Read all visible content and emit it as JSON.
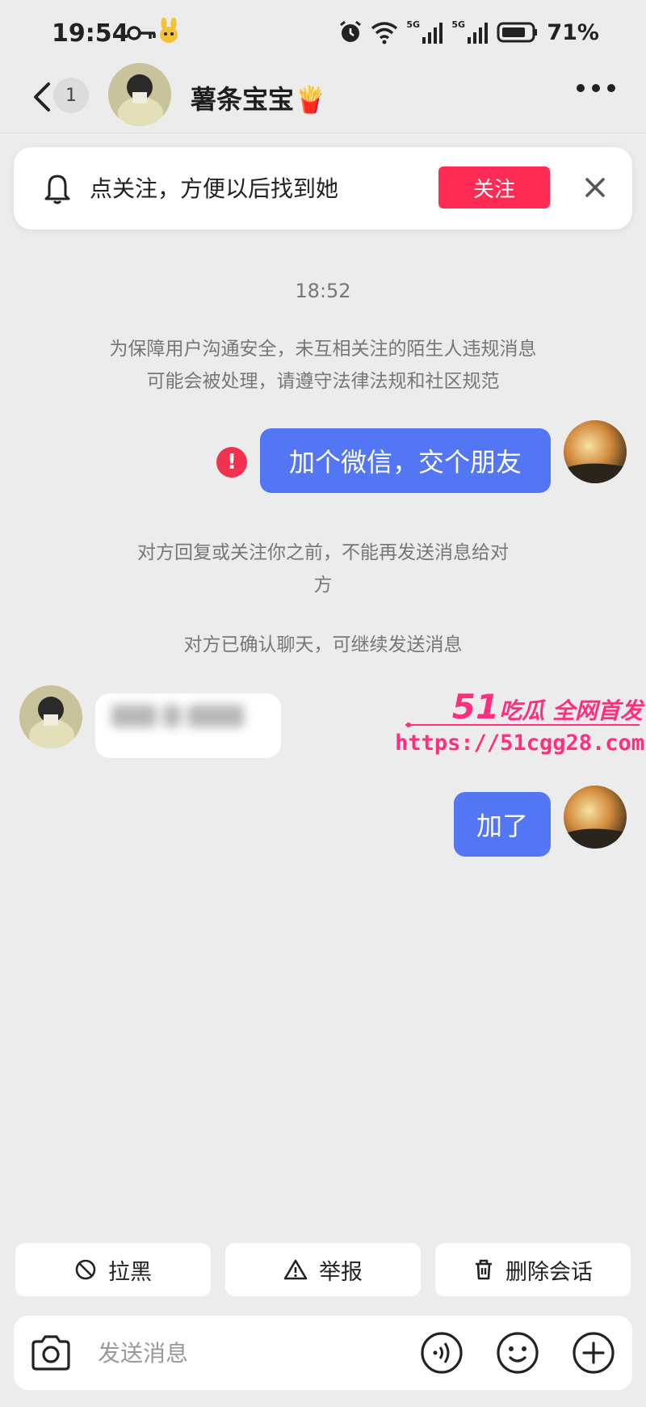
{
  "status_bar": {
    "time": "19:54",
    "battery": "71%",
    "network_1": "5G",
    "network_2": "5G"
  },
  "header": {
    "unread_count": "1",
    "title": "薯条宝宝🍟"
  },
  "follow_banner": {
    "text": "点关注，方便以后找到她",
    "button": "关注",
    "accent": "#fe2c55"
  },
  "messages": {
    "timestamp": "18:52",
    "safety_notice_line1": "为保障用户沟通安全，未互相关注的陌生人违规消息",
    "safety_notice_line2": "可能会被处理，请遵守法律法规和社区规范",
    "sent_1": "加个微信，交个朋友",
    "system_1_line1": "对方回复或关注你之前，不能再发送消息给对",
    "system_1_line2": "方",
    "system_2": "对方已确认聊天，可继续发送消息",
    "sent_2": "加了",
    "bubble_color": "#5376f5"
  },
  "watermark": {
    "top_big": "51",
    "top_text": "吃瓜 全网首发",
    "url": "https://51cgg28.com"
  },
  "actions": {
    "block": "拉黑",
    "report": "举报",
    "delete": "删除会话"
  },
  "input_bar": {
    "placeholder": "发送消息"
  }
}
